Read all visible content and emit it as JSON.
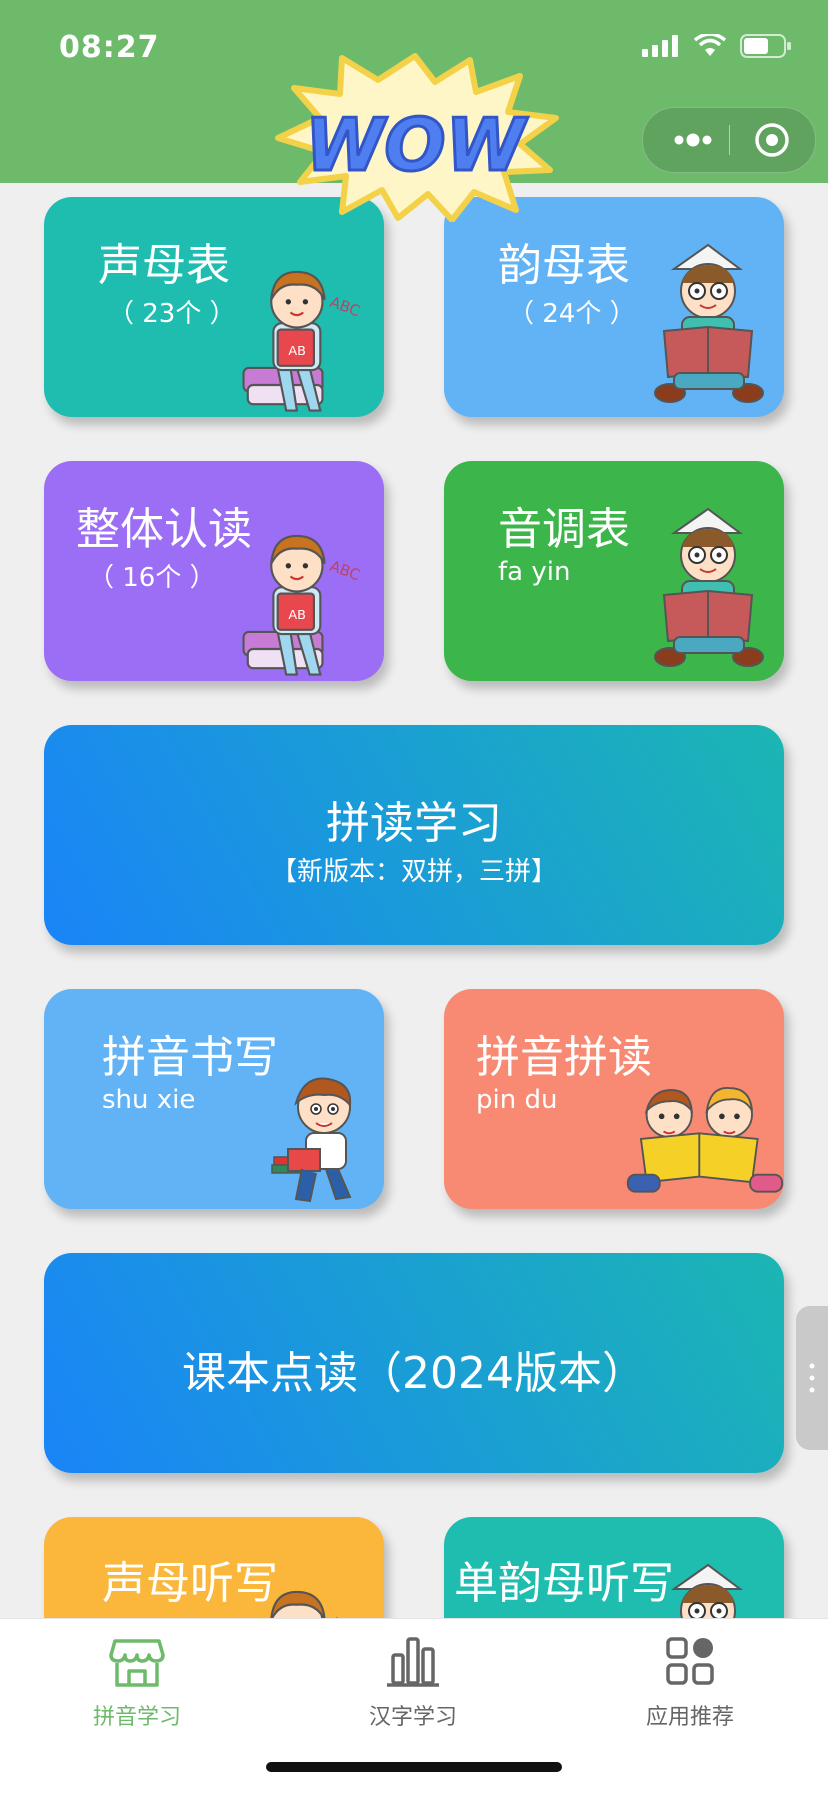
{
  "status_bar": {
    "time": "08:27"
  },
  "header": {
    "logo_text": "WOW"
  },
  "cards": {
    "shengmu": {
      "title": "声母表",
      "sub": "（ 23个 ）",
      "color": "#1fbdb0"
    },
    "yunmu": {
      "title": "韵母表",
      "sub": "（ 24个 ）",
      "color": "#62b3f6"
    },
    "zhengti": {
      "title": "整体认读",
      "sub": "（ 16个 ）",
      "color": "#9c6ef5"
    },
    "yindiao": {
      "title": "音调表",
      "sub": "fa yin",
      "color": "#3cb54a"
    },
    "pindu_study": {
      "title": "拼读学习",
      "sub": "【新版本：双拼，三拼】"
    },
    "shuxie": {
      "title": "拼音书写",
      "sub": "shu xie",
      "color": "#62b3f6"
    },
    "pindu": {
      "title": "拼音拼读",
      "sub": "pin du",
      "color": "#f88a73"
    },
    "kebeng": {
      "title": "课本点读（2024版本）"
    },
    "shengmu_tingxie": {
      "title": "声母听写",
      "color": "#fbb73c"
    },
    "danyunmu_tingxie": {
      "title": "单韵母听写",
      "color": "#1fbdb0"
    }
  },
  "tabbar": {
    "tabs": [
      {
        "label": "拼音学习",
        "icon": "store-icon",
        "active": true
      },
      {
        "label": "汉字学习",
        "icon": "bar-chart-icon",
        "active": false
      },
      {
        "label": "应用推荐",
        "icon": "apps-grid-icon",
        "active": false
      }
    ]
  },
  "colors": {
    "header": "#6dba6b",
    "gradient_start": "#1a8cf6",
    "gradient_end": "#1bb3b5",
    "tab_active": "#6dba6b"
  }
}
